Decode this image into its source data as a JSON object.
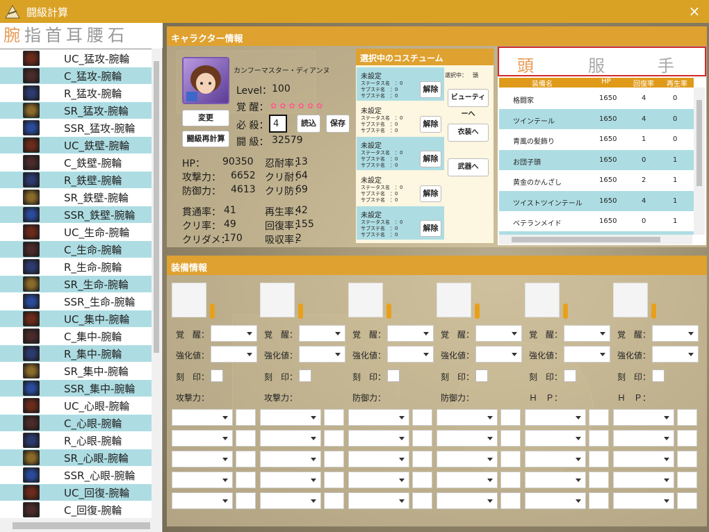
{
  "window": {
    "title": "闘級計算",
    "close": "×"
  },
  "slot_tabs": [
    "腕",
    "指",
    "首",
    "耳",
    "腰",
    "石"
  ],
  "equip_list": [
    "UC_猛攻-腕輪",
    "C_猛攻-腕輪",
    "R_猛攻-腕輪",
    "SR_猛攻-腕輪",
    "SSR_猛攻-腕輪",
    "UC_鉄壁-腕輪",
    "C_鉄壁-腕輪",
    "R_鉄壁-腕輪",
    "SR_鉄壁-腕輪",
    "SSR_鉄壁-腕輪",
    "UC_生命-腕輪",
    "C_生命-腕輪",
    "R_生命-腕輪",
    "SR_生命-腕輪",
    "SSR_生命-腕輪",
    "UC_集中-腕輪",
    "C_集中-腕輪",
    "R_集中-腕輪",
    "SR_集中-腕輪",
    "SSR_集中-腕輪",
    "UC_心眼-腕輪",
    "C_心眼-腕輪",
    "R_心眼-腕輪",
    "SR_心眼-腕輪",
    "SSR_心眼-腕輪",
    "UC_回復-腕輪",
    "C_回復-腕輪"
  ],
  "character": {
    "header": "キャラクター情報",
    "name": "カンフーマスター・ディアンヌ",
    "level_label": "Level：",
    "level": "100",
    "awaken_label": "覚 醒：",
    "special_label": "必 殺：",
    "special_value": "4",
    "power_label": "闘 級：",
    "power": "32579",
    "buttons": {
      "change": "変更",
      "recalc": "闘級再計算",
      "load": "読込",
      "save": "保存"
    },
    "stats": [
      {
        "l": "HP：",
        "v": "90350"
      },
      {
        "l": "忍耐率：",
        "v": "13"
      },
      {
        "l": "攻撃力：",
        "v": "6652"
      },
      {
        "l": "クリ耐：",
        "v": "64"
      },
      {
        "l": "防御力：",
        "v": "4613"
      },
      {
        "l": "クリ防：",
        "v": "69"
      },
      {
        "l": "貫通率：",
        "v": "41"
      },
      {
        "l": "再生率：",
        "v": "42"
      },
      {
        "l": "クリ率：",
        "v": "49"
      },
      {
        "l": "回復率：",
        "v": "155"
      },
      {
        "l": "クリダメ：",
        "v": "170"
      },
      {
        "l": "吸収率：",
        "v": "2"
      }
    ]
  },
  "costume": {
    "header": "選択中のコスチューム",
    "selected_label": "選択中：",
    "selected_value": "頭",
    "entries": [
      {
        "name": "未設定",
        "s1": "ステータス名　：0",
        "s2": "サブステ名　：0",
        "s3": "サブステ名　：0",
        "btn": "解除"
      },
      {
        "name": "未設定",
        "s1": "ステータス名　：0",
        "s2": "サブステ名　：0",
        "s3": "サブステ名　：0",
        "btn": "解除"
      },
      {
        "name": "未設定",
        "s1": "ステータス名　：0",
        "s2": "サブステ名　：0",
        "s3": "サブステ名　：0",
        "btn": "解除"
      },
      {
        "name": "未設定",
        "s1": "ステータス名　：0",
        "s2": "サブステ名　：0",
        "s3": "サブステ名　：0",
        "btn": "解除"
      },
      {
        "name": "未設定",
        "s1": "ステータス名　：0",
        "s2": "サブステ名　：0",
        "s3": "サブステ名　：0",
        "btn": "解除"
      }
    ],
    "nav": [
      "ビューティーへ",
      "衣装へ",
      "武器へ"
    ]
  },
  "costume_table": {
    "tabs": [
      "頭",
      "服",
      "手"
    ],
    "columns": [
      "装備名",
      "HP",
      "回復率",
      "再生率"
    ],
    "rows": [
      [
        "格闘家",
        "1650",
        "4",
        "0"
      ],
      [
        "ツインテール",
        "1650",
        "4",
        "0"
      ],
      [
        "青風の髪飾り",
        "1650",
        "1",
        "0"
      ],
      [
        "お団子頭",
        "1650",
        "0",
        "1"
      ],
      [
        "黄金のかんざし",
        "1650",
        "2",
        "1"
      ],
      [
        "ツイストツインテール",
        "1650",
        "4",
        "1"
      ],
      [
        "ベテランメイド",
        "1650",
        "0",
        "1"
      ]
    ]
  },
  "equipment": {
    "header": "装備情報",
    "awaken_label": "覚　醒：",
    "enhance_label": "強化値：",
    "engrave_label": "刻　印：",
    "main_stats": [
      "攻撃力：",
      "攻撃力：",
      "防御力：",
      "防御力：",
      "Ｈ　Ｐ：",
      "Ｈ　Ｐ："
    ]
  }
}
